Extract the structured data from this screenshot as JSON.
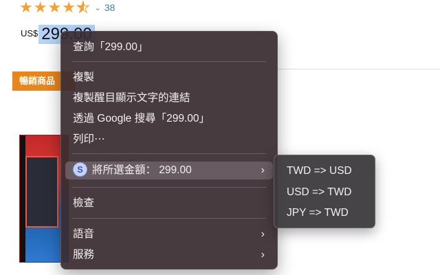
{
  "product": {
    "rating_count": "38",
    "price_currency": "US$",
    "price_amount": "299.00",
    "badge_label": "暢銷商品"
  },
  "context_menu": {
    "lookup": "查詢「299.00」",
    "copy": "複製",
    "copy_link": "複製醒目顯示文字的連結",
    "google_search": "透過 Google 搜尋「299.00」",
    "print": "列印⋯",
    "extension_item": "將所選金額： 299.00",
    "inspect": "檢查",
    "speech": "語音",
    "services": "服務"
  },
  "submenu": {
    "items": [
      "TWD => USD",
      "USD => TWD",
      "JPY => TWD"
    ]
  },
  "icons": {
    "star": "star-icon",
    "chevron_right": "chevron-right-icon",
    "extension": "currency-extension-icon"
  },
  "colors": {
    "star": "#f0a233",
    "selection_highlight": "#b5d3f7",
    "badge": "#e8851b",
    "menu_bg": "#3a2c30",
    "link": "#3b7fb0"
  }
}
